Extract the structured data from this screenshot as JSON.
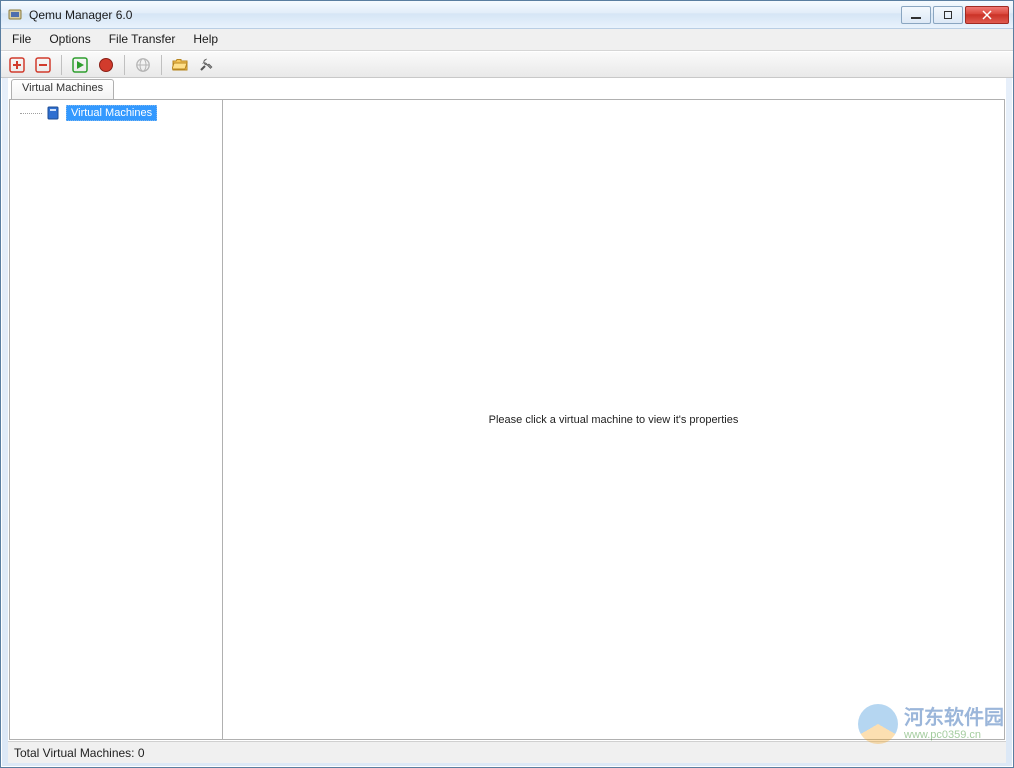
{
  "window": {
    "title": "Qemu Manager 6.0"
  },
  "menu": {
    "items": [
      "File",
      "Options",
      "File Transfer",
      "Help"
    ]
  },
  "toolbar": {
    "buttons": [
      {
        "name": "add-vm",
        "icon": "plus",
        "color": "#d13b2c"
      },
      {
        "name": "remove-vm",
        "icon": "minus",
        "color": "#d13b2c"
      },
      {
        "sep": true
      },
      {
        "name": "start-vm",
        "icon": "play",
        "color": "#2e9e2e"
      },
      {
        "name": "stop-vm",
        "icon": "stop",
        "color": "#d13b2c"
      },
      {
        "sep": true
      },
      {
        "name": "network",
        "icon": "globe",
        "color": "#8a8a8a",
        "disabled": true
      },
      {
        "sep": true
      },
      {
        "name": "open-folder",
        "icon": "folder",
        "color": "#e6a72b"
      },
      {
        "name": "tools",
        "icon": "tools",
        "color": "#666"
      }
    ]
  },
  "tabs": {
    "active": "Virtual Machines"
  },
  "tree": {
    "root": {
      "label": "Virtual Machines",
      "selected": true
    }
  },
  "detail": {
    "placeholder": "Please click a virtual machine to view it's properties"
  },
  "statusbar": {
    "text": "Total Virtual Machines: 0"
  },
  "watermark": {
    "main": "河东软件园",
    "sub": "www.pc0359.cn"
  }
}
